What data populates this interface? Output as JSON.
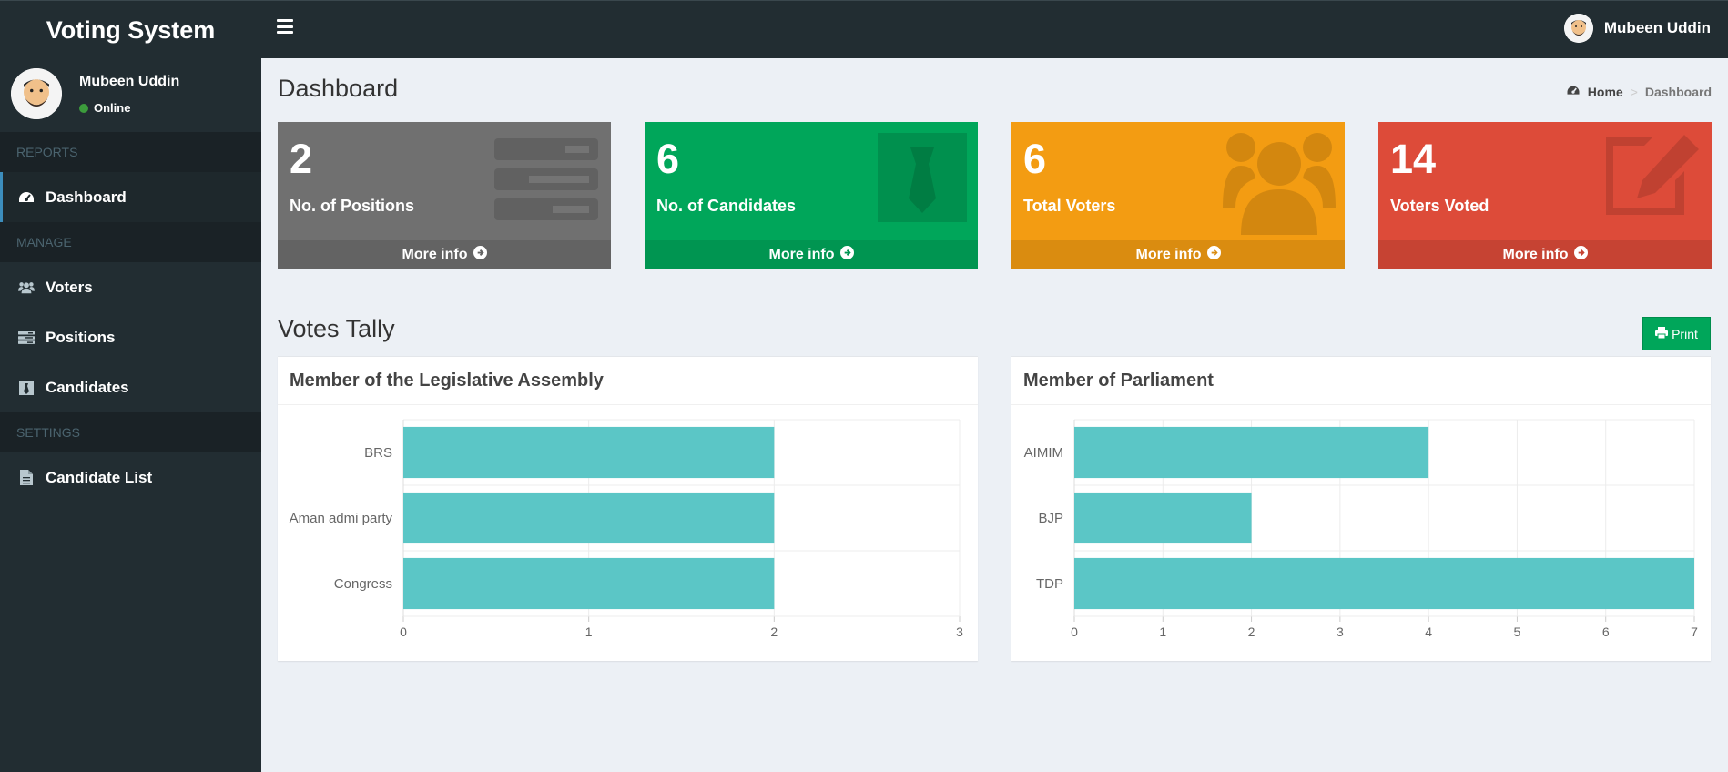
{
  "app": {
    "title": "Voting System"
  },
  "user": {
    "name": "Mubeen Uddin",
    "status": "Online"
  },
  "sidebar": {
    "sections": [
      {
        "header": "REPORTS",
        "items": [
          {
            "label": "Dashboard",
            "icon": "dashboard-icon",
            "active": true
          }
        ]
      },
      {
        "header": "MANAGE",
        "items": [
          {
            "label": "Voters",
            "icon": "users-icon"
          },
          {
            "label": "Positions",
            "icon": "tasks-icon"
          },
          {
            "label": "Candidates",
            "icon": "black-tie-icon"
          }
        ]
      },
      {
        "header": "SETTINGS",
        "items": [
          {
            "label": "Candidate List",
            "icon": "file-text-icon"
          }
        ]
      }
    ]
  },
  "page": {
    "title": "Dashboard"
  },
  "breadcrumb": {
    "home": "Home",
    "current": "Dashboard"
  },
  "stats": [
    {
      "value": "2",
      "label": "No. of Positions",
      "footer": "More info",
      "color": "#707070",
      "foot_color": "#636363",
      "icon": "tasks-icon"
    },
    {
      "value": "6",
      "label": "No. of Candidates",
      "footer": "More info",
      "color": "#00a65a",
      "foot_color": "#009551",
      "icon": "black-tie-icon"
    },
    {
      "value": "6",
      "label": "Total Voters",
      "footer": "More info",
      "color": "#f39c12",
      "foot_color": "#da8c10",
      "icon": "users-icon"
    },
    {
      "value": "14",
      "label": "Voters Voted",
      "footer": "More info",
      "color": "#dd4b39",
      "foot_color": "#c64333",
      "icon": "edit-icon"
    }
  ],
  "tally": {
    "title": "Votes Tally",
    "print_label": "Print"
  },
  "chart_data": [
    {
      "type": "bar",
      "orientation": "horizontal",
      "title": "Member of the Legislative Assembly",
      "categories": [
        "BRS",
        "Aman admi party",
        "Congress"
      ],
      "values": [
        2,
        2,
        2
      ],
      "xlim": [
        0,
        3
      ],
      "xticks": [
        0,
        1,
        2,
        3
      ],
      "color": "#5bc6c6",
      "grid": true
    },
    {
      "type": "bar",
      "orientation": "horizontal",
      "title": "Member of Parliament",
      "categories": [
        "AIMIM",
        "BJP",
        "TDP"
      ],
      "values": [
        4,
        2,
        7
      ],
      "xlim": [
        0,
        7
      ],
      "xticks": [
        0,
        1,
        2,
        3,
        4,
        5,
        6,
        7
      ],
      "color": "#5bc6c6",
      "grid": true
    }
  ]
}
